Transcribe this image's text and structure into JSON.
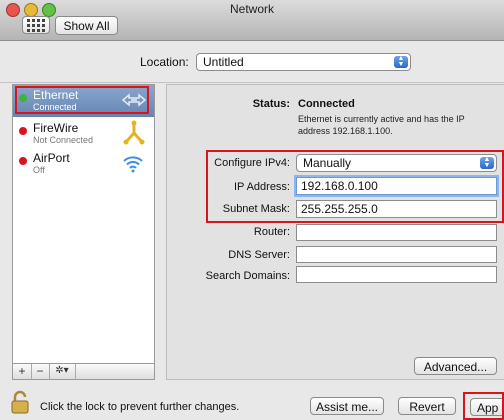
{
  "window": {
    "title": "Network"
  },
  "toolbar": {
    "show_all_label": "Show All"
  },
  "location": {
    "label": "Location:",
    "value": "Untitled"
  },
  "sidebar": {
    "items": [
      {
        "name": "Ethernet",
        "status": "Connected",
        "status_color": "#3fb33f",
        "icon": "ethernet-arrows-icon"
      },
      {
        "name": "FireWire",
        "status": "Not Connected",
        "status_color": "#d8141e",
        "icon": "firewire-icon"
      },
      {
        "name": "AirPort",
        "status": "Off",
        "status_color": "#d8141e",
        "icon": "wifi-icon"
      }
    ],
    "add_label": "+",
    "remove_label": "−",
    "action_label": "✲▾"
  },
  "status": {
    "label": "Status:",
    "value": "Connected",
    "description": "Ethernet is currently active and has the IP address 192.168.1.100."
  },
  "form": {
    "configure_label": "Configure IPv4:",
    "configure_value": "Manually",
    "ip_label": "IP Address:",
    "ip_value": "192.168.0.100",
    "subnet_label": "Subnet Mask:",
    "subnet_value": "255.255.255.0",
    "router_label": "Router:",
    "router_value": "",
    "dns_label": "DNS Server:",
    "dns_value": "",
    "search_label": "Search Domains:",
    "search_value": ""
  },
  "buttons": {
    "advanced": "Advanced...",
    "assist": "Assist me...",
    "revert": "Revert",
    "apply": "App"
  },
  "lock": {
    "text": "Click the lock to prevent further changes."
  },
  "colors": {
    "highlight": "#d8141e",
    "selection": "#6485b3"
  }
}
